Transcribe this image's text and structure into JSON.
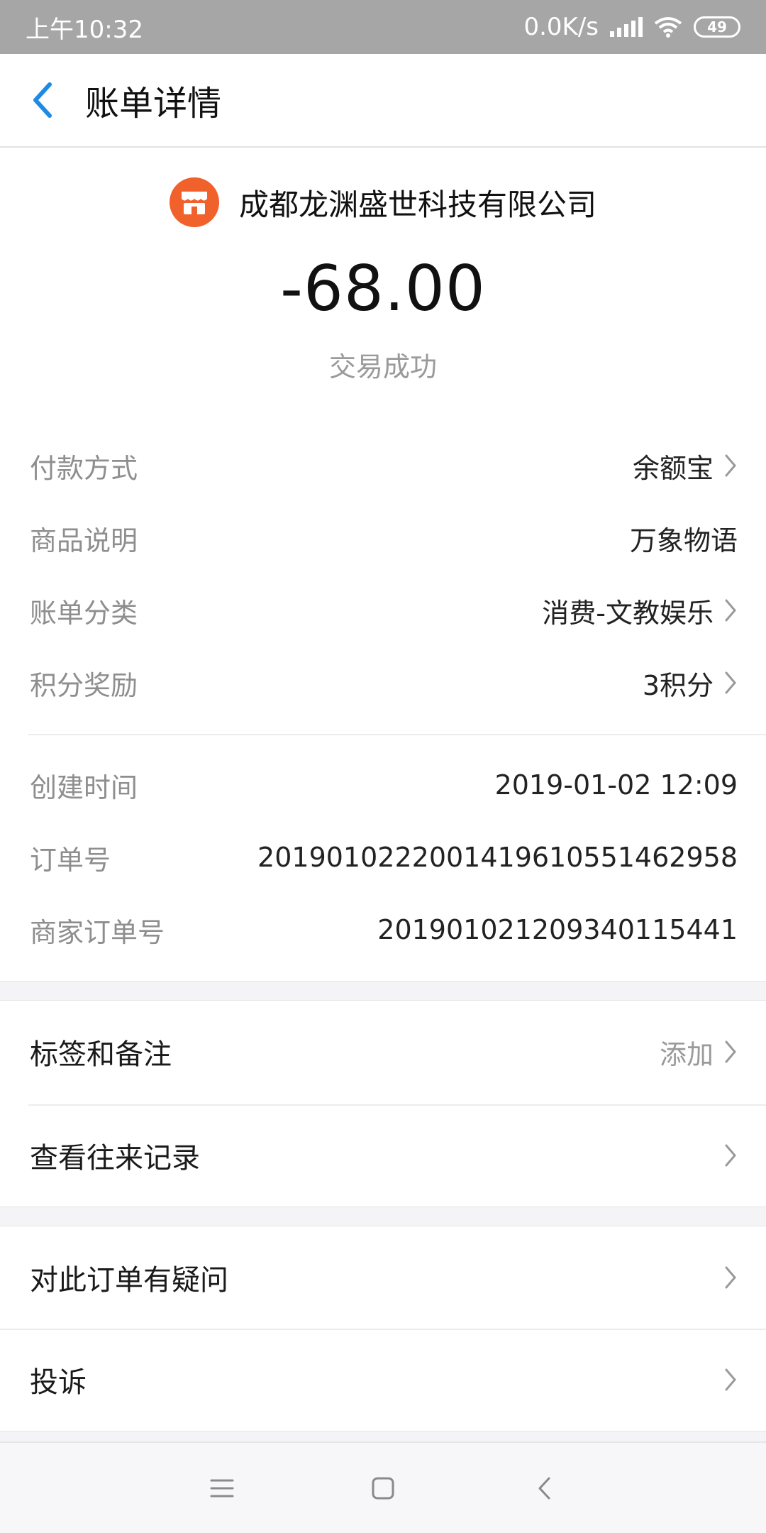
{
  "status_bar": {
    "time": "上午10:32",
    "network_speed": "0.0K/s",
    "battery": "49"
  },
  "nav": {
    "title": "账单详情",
    "back_icon": "chevron-left-icon",
    "accent_color": "#1e8ae6"
  },
  "header": {
    "merchant_icon": "shop-icon",
    "merchant_icon_color": "#f0612c",
    "merchant_name": "成都龙渊盛世科技有限公司",
    "amount": "-68.00",
    "status": "交易成功"
  },
  "details": [
    {
      "label": "付款方式",
      "value": "余额宝",
      "has_arrow": true
    },
    {
      "label": "商品说明",
      "value": "万象物语",
      "has_arrow": false
    },
    {
      "label": "账单分类",
      "value": "消费-文教娱乐",
      "has_arrow": true
    },
    {
      "label": "积分奖励",
      "value": "3积分",
      "has_arrow": true
    }
  ],
  "order_info": [
    {
      "label": "创建时间",
      "value": "2019-01-02 12:09"
    },
    {
      "label": "订单号",
      "value": "20190102220014196105514629​58"
    },
    {
      "label": "商家订单号",
      "value": "201901021209340115441"
    }
  ],
  "actions_group1": [
    {
      "label": "标签和备注",
      "value": "添加"
    },
    {
      "label": "查看往来记录",
      "value": ""
    }
  ],
  "actions_group2": [
    {
      "label": "对此订单有疑问",
      "value": ""
    },
    {
      "label": "投诉",
      "value": ""
    }
  ],
  "system_nav": [
    "menu-icon",
    "home-icon",
    "back-icon"
  ]
}
